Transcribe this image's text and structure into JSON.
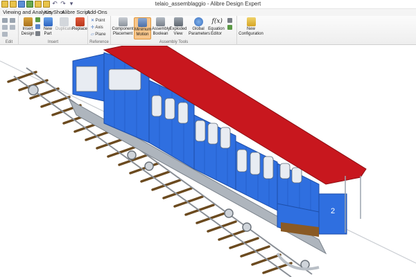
{
  "window": {
    "title": "telaio_assemblaggio - Alibre Design Expert"
  },
  "menu": {
    "items": [
      "Viewing and Analysis",
      "KeyShot",
      "Alibre Script",
      "Add-Ons"
    ]
  },
  "ribbon": {
    "edit": {
      "label": "Edit"
    },
    "insert": {
      "label": "Insert",
      "insert_design": "Insert Design",
      "new_part": "New Part",
      "duplicate": "Duplicate",
      "replace": "Replace"
    },
    "reference": {
      "label": "Reference",
      "point": "Point",
      "axis": "Axis",
      "plane": "Plane"
    },
    "assembly_tools": {
      "label": "Assembly Tools",
      "component_placement": "Component Placement",
      "minimum_motion": "Minimum Motion",
      "assembly_boolean": "Assembly Boolean",
      "exploded_view": "Exploded View",
      "global_parameters": "Global Parameters",
      "equation_editor": "Equation Editor",
      "equation_symbol": "f(x)",
      "new_configuration": "New Configuration"
    }
  },
  "model": {
    "car_number": "2",
    "colors": {
      "body": "#2f6fe0",
      "roof": "#c8171e",
      "frame": "#bfc5cc",
      "track": "#6b4a1f",
      "rail": "#8a8f96"
    }
  }
}
